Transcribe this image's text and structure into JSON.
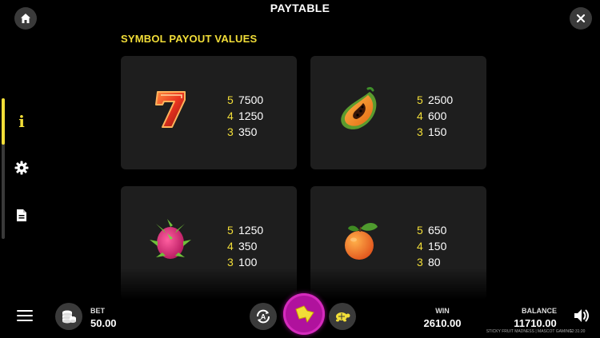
{
  "header": {
    "title": "PAYTABLE"
  },
  "paytable": {
    "heading": "SYMBOL PAYOUT VALUES",
    "symbols": [
      {
        "icon": "seven-icon",
        "payouts": [
          {
            "count": "5",
            "value": "7500"
          },
          {
            "count": "4",
            "value": "1250"
          },
          {
            "count": "3",
            "value": "350"
          }
        ]
      },
      {
        "icon": "papaya-icon",
        "payouts": [
          {
            "count": "5",
            "value": "2500"
          },
          {
            "count": "4",
            "value": "600"
          },
          {
            "count": "3",
            "value": "150"
          }
        ]
      },
      {
        "icon": "dragon-fruit-icon",
        "payouts": [
          {
            "count": "5",
            "value": "1250"
          },
          {
            "count": "4",
            "value": "350"
          },
          {
            "count": "3",
            "value": "100"
          }
        ]
      },
      {
        "icon": "orange-icon",
        "payouts": [
          {
            "count": "5",
            "value": "650"
          },
          {
            "count": "4",
            "value": "150"
          },
          {
            "count": "3",
            "value": "80"
          }
        ]
      }
    ]
  },
  "sidebar": {
    "info_label": "i",
    "items": [
      "info-icon",
      "gear-icon",
      "document-icon"
    ]
  },
  "footer": {
    "bet_label": "BET",
    "bet_value": "50.00",
    "win_label": "WIN",
    "win_value": "2610.00",
    "balance_label": "BALANCE",
    "balance_value": "11710.00",
    "brand": "STICKY FRUIT MADNESS | MASCOT GAMING",
    "clock": "12:31:20"
  },
  "colors": {
    "accent": "#f2de38",
    "spin": "#b0129d",
    "card": "#1e1e1e",
    "button": "#3a3a3a"
  }
}
